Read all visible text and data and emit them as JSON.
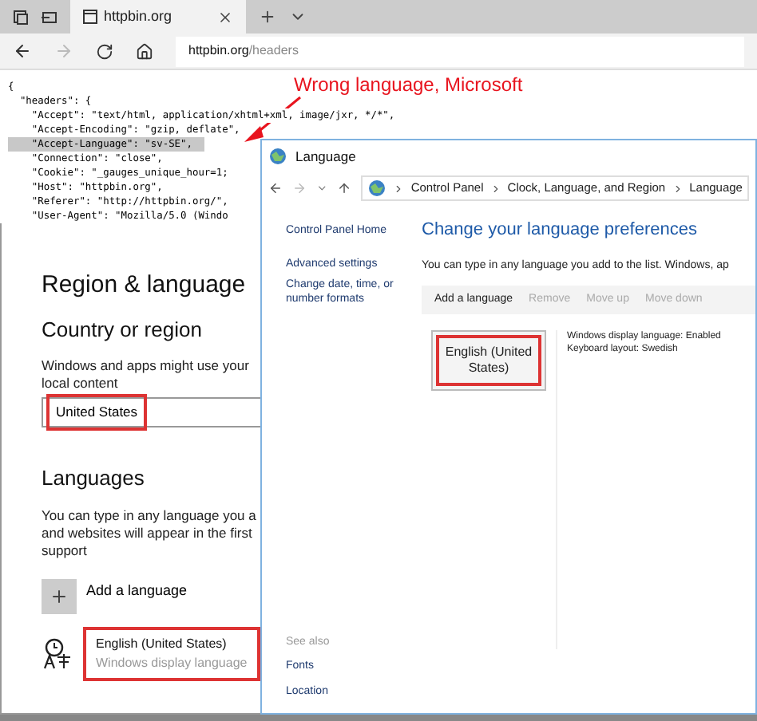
{
  "browser": {
    "tab_title": "httpbin.org",
    "address_host": "httpbin.org",
    "address_path": "/headers",
    "lines": [
      {
        "text": "{",
        "selected": false
      },
      {
        "text": "  \"headers\": {",
        "selected": false
      },
      {
        "text": "    \"Accept\": \"text/html, application/xhtml+xml, image/jxr, */*\",",
        "selected": false
      },
      {
        "text": "    \"Accept-Encoding\": \"gzip, deflate\",",
        "selected": false
      },
      {
        "text": "    \"Accept-Language\": \"sv-SE\",",
        "selected": true
      },
      {
        "text": "    \"Connection\": \"close\",",
        "selected": false
      },
      {
        "text": "    \"Cookie\": \"_gauges_unique_hour=1;",
        "selected": false
      },
      {
        "text": "    \"Host\": \"httpbin.org\",",
        "selected": false
      },
      {
        "text": "    \"Referer\": \"http://httpbin.org/\",",
        "selected": false
      },
      {
        "text": "    \"User-Agent\": \"Mozilla/5.0 (Windo",
        "selected": false
      }
    ]
  },
  "annotation": "Wrong language, Microsoft",
  "settings": {
    "title": "Region & language",
    "country_heading": "Country or region",
    "country_desc": [
      "Windows and apps might use your",
      "local content"
    ],
    "country_value": "United States",
    "languages_heading": "Languages",
    "languages_desc": [
      "You can type in any language you a",
      "and websites will appear in the first",
      "support"
    ],
    "add_language": "Add a language",
    "language_name": "English (United States)",
    "language_detail": "Windows display language"
  },
  "control_panel": {
    "title": "Language",
    "breadcrumb": [
      "Control Panel",
      "Clock, Language, and Region",
      "Language"
    ],
    "nav_links": [
      "Control Panel Home",
      "Advanced settings",
      "Change date, time, or number formats"
    ],
    "heading": "Change your language preferences",
    "description": "You can type in any language you add to the list. Windows, ap",
    "toolbar": [
      {
        "label": "Add a language",
        "disabled": false
      },
      {
        "label": "Remove",
        "disabled": true
      },
      {
        "label": "Move up",
        "disabled": true
      },
      {
        "label": "Move down",
        "disabled": true
      }
    ],
    "language": {
      "name": "English (United States)",
      "details": [
        "Windows display language: Enabled",
        "Keyboard layout: Swedish"
      ]
    },
    "see_also": {
      "heading": "See also",
      "links": [
        "Fonts",
        "Location"
      ]
    }
  }
}
